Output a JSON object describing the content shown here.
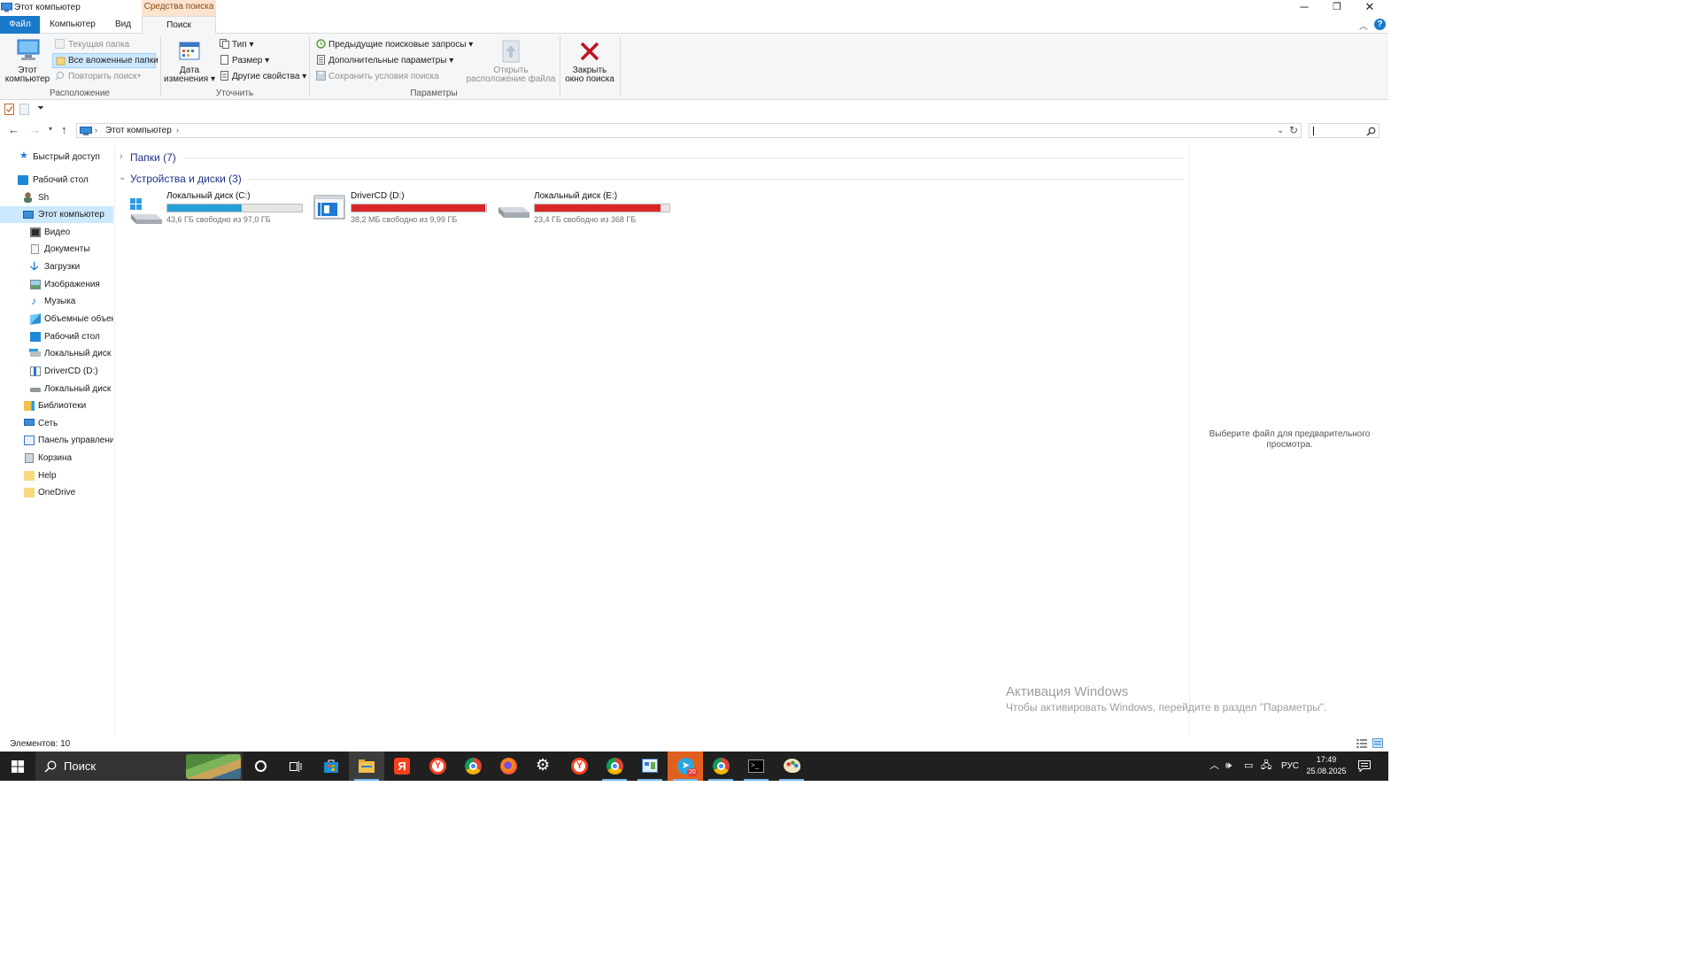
{
  "window": {
    "title": "Этот компьютер",
    "context_tab": "Средства поиска"
  },
  "ribbon": {
    "tabs": [
      "Файл",
      "Компьютер",
      "Вид",
      "Поиск"
    ],
    "location": {
      "this_pc_line1": "Этот",
      "this_pc_line2": "компьютер",
      "current_folder": "Текущая папка",
      "all_subfolders": "Все вложенные папки",
      "search_again": "Повторить поиск",
      "group": "Расположение"
    },
    "refine": {
      "date_line1": "Дата",
      "date_line2": "изменения",
      "type": "Тип",
      "size": "Размер",
      "other": "Другие свойства",
      "group": "Уточнить"
    },
    "options": {
      "recent": "Предыдущие поисковые запросы",
      "advanced": "Дополнительные параметры",
      "save": "Сохранить условия поиска",
      "open_line1": "Открыть",
      "open_line2": "расположение файла",
      "group": "Параметры"
    },
    "close": {
      "line1": "Закрыть",
      "line2": "окно поиска"
    }
  },
  "address": {
    "crumb": "Этот компьютер"
  },
  "nav": {
    "items": [
      {
        "label": "Быстрый доступ"
      },
      {
        "label": "Рабочий стол"
      },
      {
        "label": "Sh"
      },
      {
        "label": "Этот компьютер"
      },
      {
        "label": "Видео"
      },
      {
        "label": "Документы"
      },
      {
        "label": "Загрузки"
      },
      {
        "label": "Изображения"
      },
      {
        "label": "Музыка"
      },
      {
        "label": "Объемные объек"
      },
      {
        "label": "Рабочий стол"
      },
      {
        "label": "Локальный диск"
      },
      {
        "label": "DriverCD (D:)"
      },
      {
        "label": "Локальный диск"
      },
      {
        "label": "Библиотеки"
      },
      {
        "label": "Сеть"
      },
      {
        "label": "Панель управлени"
      },
      {
        "label": "Корзина"
      },
      {
        "label": "Help"
      },
      {
        "label": "OneDrive"
      }
    ]
  },
  "main": {
    "folders_header": "Папки (7)",
    "devices_header": "Устройства и диски (3)",
    "drives": [
      {
        "name": "Локальный диск (C:)",
        "info": "43,6 ГБ свободно из 97,0 ГБ",
        "used_fraction": 0.55,
        "bar_color": "#26a0da"
      },
      {
        "name": "DriverCD (D:)",
        "info": "38,2 МБ свободно из 9,99 ГБ",
        "used_fraction": 0.996,
        "bar_color": "#da2626"
      },
      {
        "name": "Локальный диск (E:)",
        "info": "23,4 ГБ свободно из 368 ГБ",
        "used_fraction": 0.936,
        "bar_color": "#da2626"
      }
    ]
  },
  "preview": {
    "text": "Выберите файл для предварительного просмотра."
  },
  "watermark": {
    "title": "Активация Windows",
    "subtitle": "Чтобы активировать Windows, перейдите в раздел \"Параметры\"."
  },
  "status": {
    "items": "Элементов: 10"
  },
  "taskbar": {
    "search_label": "Поиск",
    "lang": "РУС",
    "time": "17:49",
    "date": "25.08.2025",
    "telegram_badge": "20"
  }
}
